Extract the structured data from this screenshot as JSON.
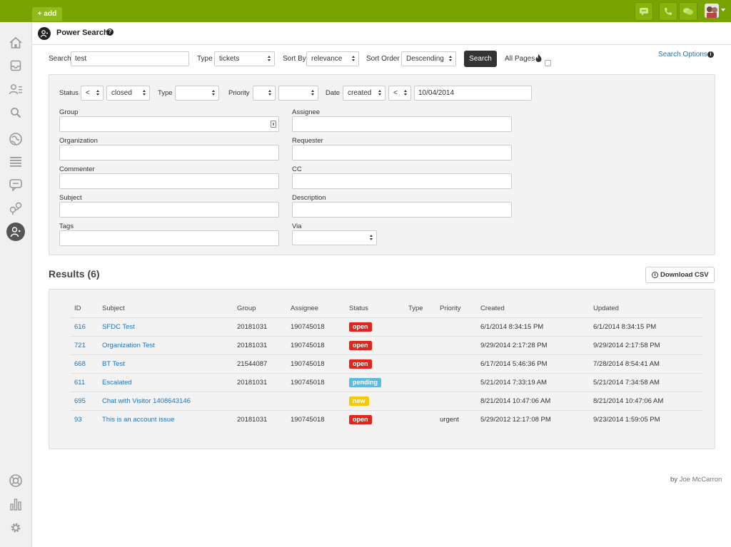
{
  "topbar": {
    "add_label": "+ add",
    "color": "#78a300",
    "icons": [
      "chat-icon",
      "phone-icon",
      "comments-icon"
    ]
  },
  "sidebar": {
    "items": [
      {
        "name": "home-icon"
      },
      {
        "name": "views-icon"
      },
      {
        "name": "customers-icon"
      },
      {
        "name": "search-icon"
      },
      {
        "name": "reporting-icon"
      },
      {
        "name": "list-icon"
      },
      {
        "name": "chat-icon"
      },
      {
        "name": "app-icon"
      },
      {
        "name": "power-search-icon",
        "active": true
      },
      {
        "name": "help-icon"
      },
      {
        "name": "stats-icon"
      },
      {
        "name": "settings-icon"
      }
    ]
  },
  "header": {
    "title": "Power Search"
  },
  "search": {
    "search_label": "Search",
    "search_value": "test",
    "type_label": "Type",
    "type_value": "tickets",
    "sort_by_label": "Sort By",
    "sort_by_value": "relevance",
    "sort_order_label": "Sort Order",
    "sort_order_value": "Descending",
    "search_button": "Search",
    "all_pages_label": "All Pages",
    "search_options": "Search Options"
  },
  "filters": {
    "status_label": "Status",
    "status_op": "<",
    "status_value": "closed",
    "type_label": "Type",
    "type_value": "",
    "priority_label": "Priority",
    "priority_op": "",
    "priority_value": "",
    "date_label": "Date",
    "date_field": "created",
    "date_op": "<",
    "date_value": "10/04/2014",
    "group_label": "Group",
    "assignee_label": "Assignee",
    "organization_label": "Organization",
    "requester_label": "Requester",
    "commenter_label": "Commenter",
    "cc_label": "CC",
    "subject_label": "Subject",
    "description_label": "Description",
    "tags_label": "Tags",
    "via_label": "Via",
    "via_value": ""
  },
  "results": {
    "title": "Results (6)",
    "download_csv": "Download CSV",
    "columns": [
      "ID",
      "Subject",
      "Group",
      "Assignee",
      "Status",
      "Type",
      "Priority",
      "Created",
      "Updated"
    ],
    "status_colors": {
      "open": "#e3261c",
      "pending": "#59bbe0",
      "new": "#f5ca00"
    },
    "rows": [
      {
        "id": "616",
        "subject": "SFDC Test",
        "group": "20181031",
        "assignee": "190745018",
        "status": "open",
        "type": "",
        "priority": "",
        "created": "6/1/2014 8:34:15 PM",
        "updated": "6/1/2014 8:34:15 PM"
      },
      {
        "id": "721",
        "subject": "Organization Test",
        "group": "20181031",
        "assignee": "190745018",
        "status": "open",
        "type": "",
        "priority": "",
        "created": "9/29/2014 2:17:28 PM",
        "updated": "9/29/2014 2:17:58 PM"
      },
      {
        "id": "668",
        "subject": "BT Test",
        "group": "21544087",
        "assignee": "190745018",
        "status": "open",
        "type": "",
        "priority": "",
        "created": "6/17/2014 5:46:36 PM",
        "updated": "7/28/2014 8:54:41 AM"
      },
      {
        "id": "611",
        "subject": "Escalated",
        "group": "20181031",
        "assignee": "190745018",
        "status": "pending",
        "type": "",
        "priority": "",
        "created": "5/21/2014 7:33:19 AM",
        "updated": "5/21/2014 7:34:58 AM"
      },
      {
        "id": "695",
        "subject": "Chat with Visitor 1408643146",
        "group": "",
        "assignee": "",
        "status": "new",
        "type": "",
        "priority": "",
        "created": "8/21/2014 10:47:06 AM",
        "updated": "8/21/2014 10:47:06 AM"
      },
      {
        "id": "93",
        "subject": "This is an account issue",
        "group": "20181031",
        "assignee": "190745018",
        "status": "open",
        "type": "",
        "priority": "urgent",
        "created": "5/29/2012 12:17:08 PM",
        "updated": "9/23/2014 1:59:05 PM"
      }
    ]
  },
  "footer": {
    "by": "by",
    "author": "Joe McCarron"
  }
}
